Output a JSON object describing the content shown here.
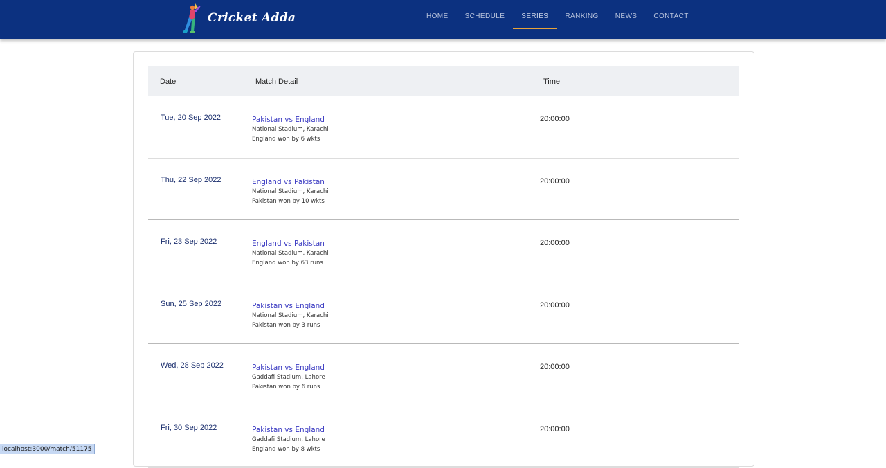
{
  "brand": {
    "name": "Cricket Adda"
  },
  "nav": {
    "items": [
      {
        "label": "HOME",
        "active": false
      },
      {
        "label": "SCHEDULE",
        "active": false
      },
      {
        "label": "SERIES",
        "active": true
      },
      {
        "label": "RANKING",
        "active": false
      },
      {
        "label": "NEWS",
        "active": false
      },
      {
        "label": "CONTACT",
        "active": false
      }
    ]
  },
  "table": {
    "headers": {
      "date": "Date",
      "detail": "Match Detail",
      "time": "Time"
    },
    "rows": [
      {
        "date": "Tue, 20 Sep 2022",
        "match": "Pakistan vs England",
        "venue": "National Stadium, Karachi",
        "result": "England won by 6 wkts",
        "time": "20:00:00"
      },
      {
        "date": "Thu, 22 Sep 2022",
        "match": "England vs Pakistan",
        "venue": "National Stadium, Karachi",
        "result": "Pakistan won by 10 wkts",
        "time": "20:00:00"
      },
      {
        "date": "Fri, 23 Sep 2022",
        "match": "England vs Pakistan",
        "venue": "National Stadium, Karachi",
        "result": "England won by 63 runs",
        "time": "20:00:00"
      },
      {
        "date": "Sun, 25 Sep 2022",
        "match": "Pakistan vs England",
        "venue": "National Stadium, Karachi",
        "result": "Pakistan won by 3 runs",
        "time": "20:00:00"
      },
      {
        "date": "Wed, 28 Sep 2022",
        "match": "Pakistan vs England",
        "venue": "Gaddafi Stadium, Lahore",
        "result": "Pakistan won by 6 runs",
        "time": "20:00:00"
      },
      {
        "date": "Fri, 30 Sep 2022",
        "match": "Pakistan vs England",
        "venue": "Gaddafi Stadium, Lahore",
        "result": "England won by 8 wkts",
        "time": "20:00:00"
      }
    ]
  },
  "status_bar": {
    "url": "localhost:3000/match/51175"
  },
  "colors": {
    "navbar": "#0c3180",
    "active_underline": "#e8a33a",
    "match_link": "#3b3bc2",
    "date_text": "#1b2f6e"
  },
  "icons": {
    "brand_logo": "cricket-batsman-icon"
  }
}
